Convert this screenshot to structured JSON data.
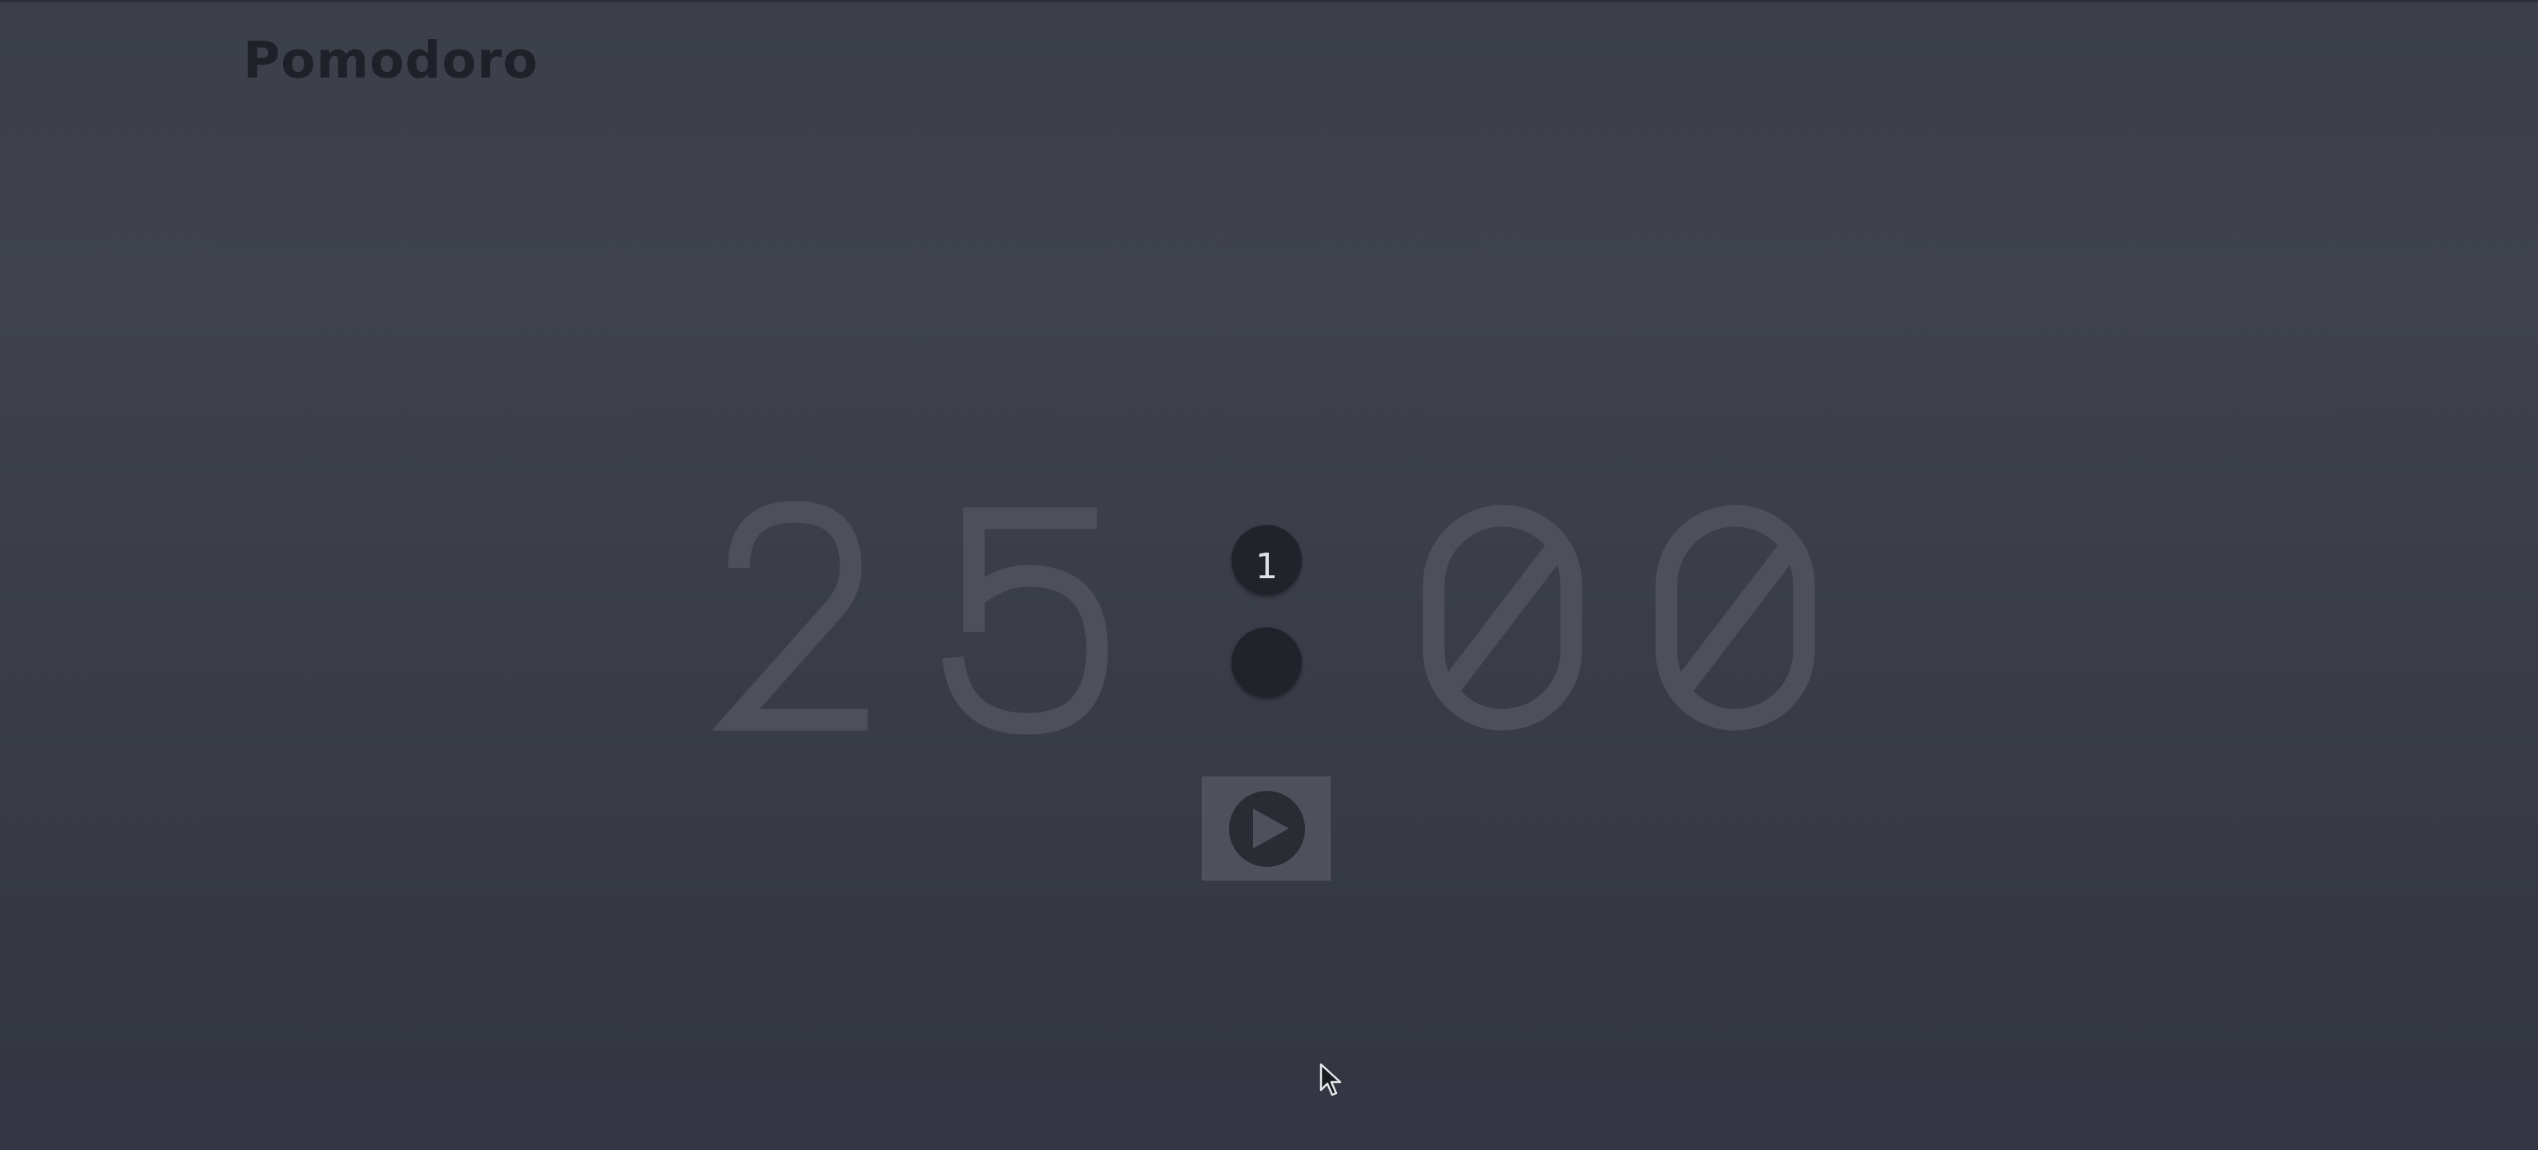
{
  "app": {
    "title": "Pomodoro"
  },
  "timer": {
    "display": "25:00",
    "minutes_tens": "2",
    "minutes_ones": "5",
    "seconds_tens": "0",
    "seconds_ones": "0"
  },
  "session": {
    "current": "1"
  },
  "controls": {
    "play_icon": "play-icon"
  },
  "colors": {
    "background": "#3c3f4a",
    "digit_stroke": "#4e5059",
    "title": "#1f2128",
    "dot": "#21232a",
    "button": "#4e515b"
  }
}
